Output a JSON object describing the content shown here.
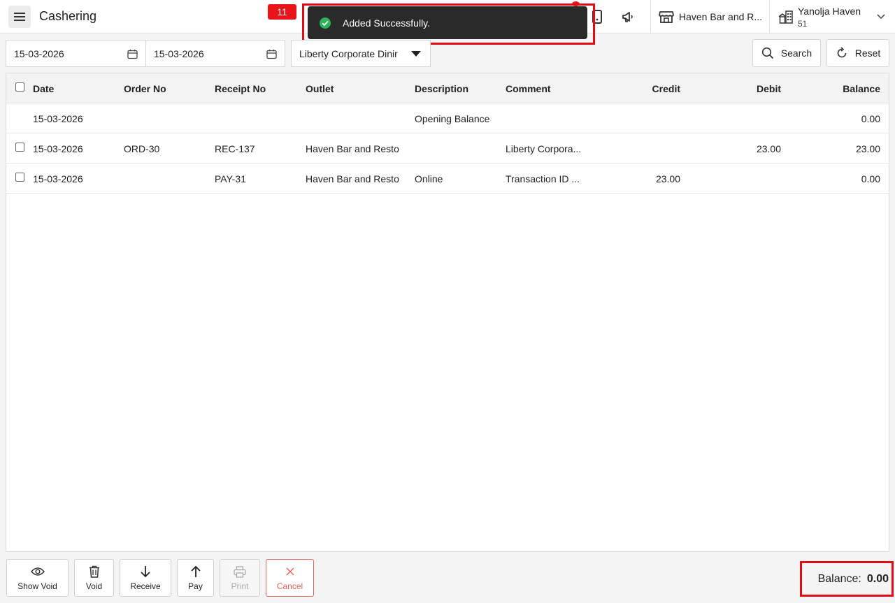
{
  "header": {
    "title": "Cashering",
    "notification_count": "11",
    "toast_message": "Added Successfully.",
    "outlet": "Haven Bar and R...",
    "user_name": "Yanolja Haven",
    "user_sub": "51"
  },
  "filters": {
    "from_date": "15-03-2026",
    "to_date": "15-03-2026",
    "account": "Liberty Corporate Dinir",
    "search_label": "Search",
    "reset_label": "Reset"
  },
  "table": {
    "headers": {
      "date": "Date",
      "order_no": "Order No",
      "receipt_no": "Receipt No",
      "outlet": "Outlet",
      "description": "Description",
      "comment": "Comment",
      "credit": "Credit",
      "debit": "Debit",
      "balance": "Balance"
    },
    "rows": [
      {
        "date": "15-03-2026",
        "order_no": "",
        "receipt_no": "",
        "outlet": "",
        "description": "Opening Balance",
        "comment": "",
        "credit": "",
        "debit": "",
        "balance": "0.00"
      },
      {
        "date": "15-03-2026",
        "order_no": "ORD-30",
        "receipt_no": "REC-137",
        "outlet": "Haven Bar and Resto",
        "description": "",
        "comment": "Liberty Corpora...",
        "credit": "",
        "debit": "23.00",
        "balance": "23.00"
      },
      {
        "date": "15-03-2026",
        "order_no": "",
        "receipt_no": "PAY-31",
        "outlet": "Haven Bar and Resto",
        "description": "Online",
        "comment": "Transaction ID ...",
        "credit": "23.00",
        "debit": "",
        "balance": "0.00"
      }
    ]
  },
  "actions": {
    "show_void": "Show Void",
    "void": "Void",
    "receive": "Receive",
    "pay": "Pay",
    "print": "Print",
    "cancel": "Cancel"
  },
  "footer": {
    "balance_label": "Balance:",
    "balance_value": "0.00"
  },
  "colors": {
    "highlight": "#e20b14",
    "badge": "#e8141a",
    "toast_bg": "#2a2a2a",
    "success": "#2db45a",
    "cancel": "#e3665f"
  }
}
